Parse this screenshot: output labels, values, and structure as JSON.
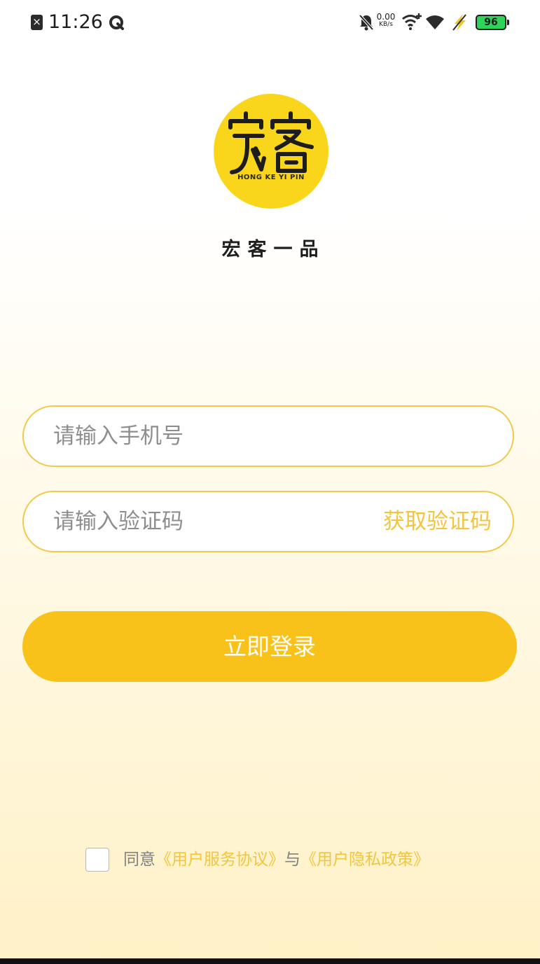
{
  "status_bar": {
    "time": "11:26",
    "net_speed_value": "0.00",
    "net_speed_unit": "KB/s",
    "battery_level": "96",
    "icons": [
      "sim-error-icon",
      "quark-browser-icon",
      "mute-bell-icon",
      "wifi-plus-icon",
      "wifi-icon",
      "charging-icon",
      "battery-icon"
    ]
  },
  "logo": {
    "mark_text": "宏客",
    "sub_text": "HONG KE YI PIN",
    "color": "#f9d61b"
  },
  "app_name": "宏客一品",
  "form": {
    "phone_placeholder": "请输入手机号",
    "code_placeholder": "请输入验证码",
    "get_code_label": "获取验证码",
    "login_label": "立即登录"
  },
  "agreement": {
    "checked": false,
    "prefix": "同意",
    "terms_link": "《用户服务协议》",
    "connector": "与",
    "privacy_link": "《用户隐私政策》"
  },
  "colors": {
    "accent": "#f9c21b",
    "link": "#f2c53d",
    "field_border": "#f2c94a"
  }
}
